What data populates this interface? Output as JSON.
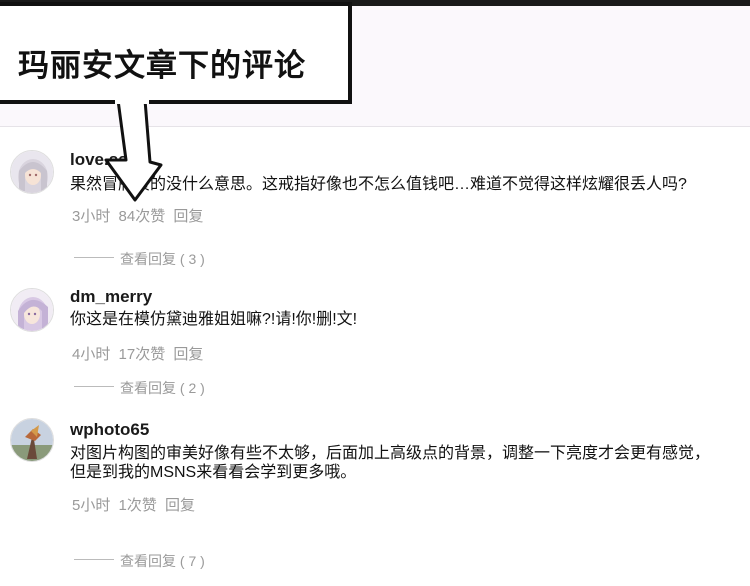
{
  "caption": "玛丽安文章下的评论",
  "comments": [
    {
      "username": "love.ssi",
      "text": "果然冒牌货的没什么意思。这戒指好像也不怎么值钱吧…难道不觉得这样炫耀很丢人吗?",
      "time": "3小时",
      "likes": "84次赞",
      "reply_label": "回复",
      "view_replies": "查看回复 ( 3 )",
      "avatar_icon": "girl-silver-hair-avatar"
    },
    {
      "username": "dm_merry",
      "text": "你这是在模仿黛迪雅姐姐嘛?!请!你!删!文!",
      "time": "4小时",
      "likes": "17次赞",
      "reply_label": "回复",
      "view_replies": "查看回复 ( 2 )",
      "avatar_icon": "girl-lavender-hair-avatar"
    },
    {
      "username": "wphoto65",
      "text_lines": [
        "对图片构图的审美好像有些不太够，后面加上高级点的背景，调整一下亮度才会更有感觉，",
        "但是到我的MSNS来看看会学到更多哦。"
      ],
      "time": "5小时",
      "likes": "1次赞",
      "reply_label": "回复",
      "view_replies": "查看回复 ( 7 )",
      "avatar_icon": "landscape-photo-avatar"
    }
  ]
}
